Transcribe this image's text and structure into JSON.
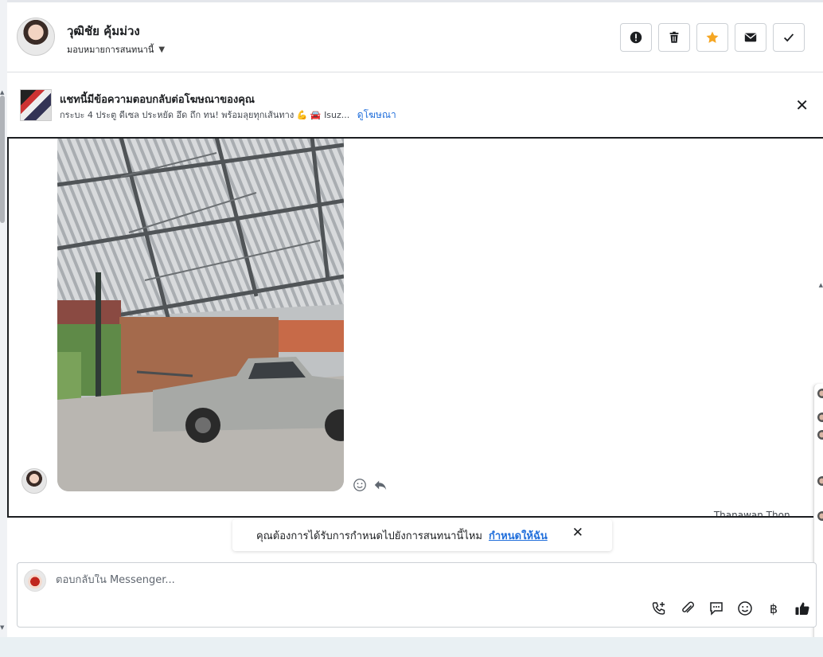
{
  "header": {
    "contact_name": "วุฒิชัย คุ้มม่วง",
    "assign_label": "มอบหมายการสนทนานี้",
    "actions": [
      {
        "name": "mark-spam-button",
        "icon": "alert-icon"
      },
      {
        "name": "delete-button",
        "icon": "trash-icon"
      },
      {
        "name": "star-button",
        "icon": "star-icon",
        "color": "#f5a623"
      },
      {
        "name": "mark-unread-button",
        "icon": "envelope-icon"
      },
      {
        "name": "mark-done-button",
        "icon": "check-icon"
      }
    ]
  },
  "ad_banner": {
    "title": "แชทนี้มีข้อความตอบกลับต่อโฆษณาของคุณ",
    "subtitle": "กระบะ 4 ประตู ดีเซล ประหยัด อึด ถึก ทน! พร้อมลุยทุกเส้นทาง 💪 🚘 Isuz...",
    "link_label": "ดูโฆษณา",
    "link_color": "#216fdb"
  },
  "conversation": {
    "seen_by": "Thanawan Thon..."
  },
  "assign_prompt": {
    "question": "คุณต้องการได้รับการกำหนดไปยังการสนทนานี้ไหม",
    "action_label": "กำหนดให้ฉัน"
  },
  "composer": {
    "placeholder": "ตอบกลับใน Messenger...",
    "currency_symbol": "฿"
  }
}
